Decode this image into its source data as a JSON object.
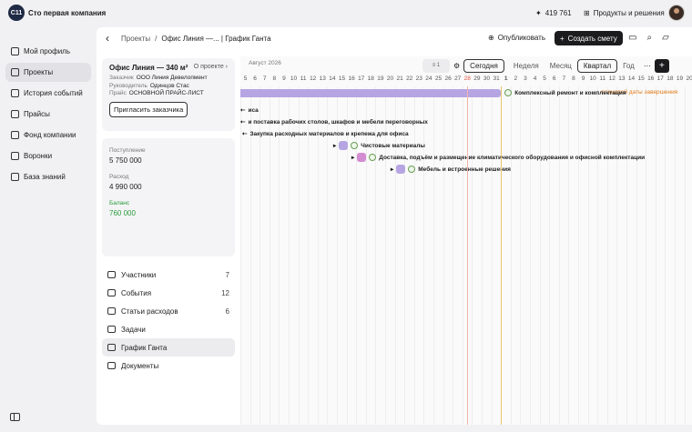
{
  "company": {
    "logo_text": "С11",
    "name": "Сто первая компания"
  },
  "topbar": {
    "balance": "419 761",
    "products_label": "Продукты и решения"
  },
  "nav": {
    "items": [
      {
        "label": "Мой профиль",
        "icon": "user-icon"
      },
      {
        "label": "Проекты",
        "icon": "projects-icon",
        "active": true
      },
      {
        "label": "История событий",
        "icon": "history-icon"
      },
      {
        "label": "Прайсы",
        "icon": "price-icon"
      },
      {
        "label": "Фонд компании",
        "icon": "wallet-icon"
      },
      {
        "label": "Воронки",
        "icon": "funnel-icon"
      },
      {
        "label": "База знаний",
        "icon": "book-icon"
      }
    ]
  },
  "header": {
    "breadcrumb": [
      "Проекты",
      "/",
      "Офис Линия —... | График Ганта"
    ],
    "publish_label": "Опубликовать",
    "create_label": "Создать смету"
  },
  "project": {
    "title": "Офис Линия — 340 м²",
    "about_label": "О проекте",
    "customer_key": "Заказчик",
    "customer_val": "ООО Линия Девелопмент",
    "manager_key": "Руководитель",
    "manager_val": "Одинцов Стас",
    "price_key": "Прайс",
    "price_val": "ОСНОВНОЙ ПРАЙС-ЛИСТ",
    "invite_label": "Пригласить заказчика"
  },
  "finance": {
    "income_label": "Поступление",
    "income_value": "5 750 000",
    "expense_label": "Расход",
    "expense_value": "4 990 000",
    "balance_label": "Баланс",
    "balance_value": "760 000",
    "balance_color": "#2a9b3a"
  },
  "menu": [
    {
      "label": "Участники",
      "count": "7"
    },
    {
      "label": "События",
      "count": "12"
    },
    {
      "label": "Статьи расходов",
      "count": "6"
    },
    {
      "label": "Задачи",
      "count": ""
    },
    {
      "label": "График Ганта",
      "count": "",
      "active": true
    },
    {
      "label": "Документы",
      "count": ""
    }
  ],
  "gantt": {
    "month": "Август 2026",
    "filter_count": "1",
    "today_label": "Сегодня",
    "scales": [
      "Неделя",
      "Месяц",
      "Квартал",
      "Год"
    ],
    "selected_scale": "Квартал",
    "days": [
      "5",
      "6",
      "7",
      "8",
      "9",
      "10",
      "11",
      "12",
      "13",
      "14",
      "15",
      "16",
      "17",
      "18",
      "19",
      "20",
      "21",
      "22",
      "23",
      "24",
      "25",
      "26",
      "27",
      "28",
      "29",
      "30",
      "31",
      "1",
      "2",
      "3",
      "4",
      "5",
      "6",
      "7",
      "8",
      "9",
      "10",
      "11",
      "12",
      "13",
      "14",
      "15",
      "16",
      "17",
      "18",
      "19",
      "20"
    ],
    "today_day": "28",
    "tasks": [
      {
        "title": "Комплексный ремонт и комплектация",
        "late": "плановой даты завершения"
      },
      {
        "title": "иса"
      },
      {
        "title": "и поставка рабочих столов, шкафов и мебели переговорных"
      },
      {
        "title": "Закупка расходных материалов и крепежа для офиса"
      },
      {
        "title": "Чистовые материалы",
        "color": "#b6a5e2"
      },
      {
        "title": "Доставка, подъём и размещение климатического оборудования и офисной комплектации",
        "color": "#d38bd1"
      },
      {
        "title": "Мебель и встроенные решения",
        "color": "#b6a5e2"
      }
    ]
  }
}
